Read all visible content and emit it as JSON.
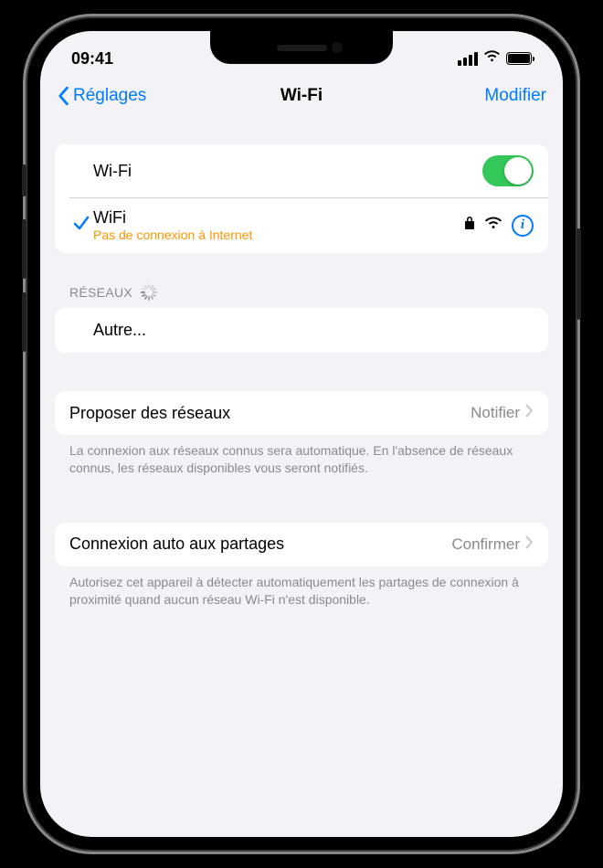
{
  "status": {
    "time": "09:41"
  },
  "nav": {
    "back": "Réglages",
    "title": "Wi-Fi",
    "edit": "Modifier"
  },
  "wifi": {
    "toggle_label": "Wi-Fi",
    "connected": {
      "name": "WiFi",
      "status": "Pas de connexion à Internet"
    }
  },
  "networks": {
    "header": "RÉSEAUX",
    "other": "Autre..."
  },
  "ask_join": {
    "label": "Proposer des réseaux",
    "value": "Notifier",
    "footer": "La connexion aux réseaux connus sera automatique. En l'absence de réseaux connus, les réseaux disponibles vous seront notifiés."
  },
  "hotspot": {
    "label": "Connexion auto aux partages",
    "value": "Confirmer",
    "footer": "Autorisez cet appareil à détecter automatiquement les partages de connexion à proximité quand aucun réseau Wi-Fi n'est disponible."
  }
}
